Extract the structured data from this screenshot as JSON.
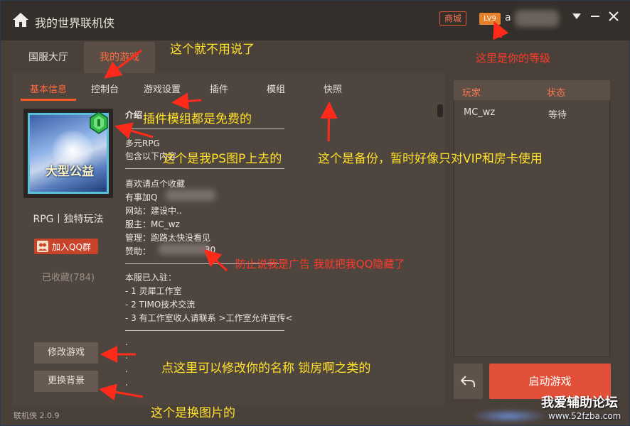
{
  "app": {
    "title": "我的世界联机侠",
    "version": "联机侠 2.0.9"
  },
  "header": {
    "shop": "商城",
    "level": "LV9",
    "username_visible": "a"
  },
  "top_tabs": [
    {
      "label": "国服大厅",
      "active": false
    },
    {
      "label": "我的游戏",
      "active": true
    }
  ],
  "sub_tabs": [
    {
      "label": "基本信息",
      "active": true
    },
    {
      "label": "控制台",
      "active": false
    },
    {
      "label": "游戏设置",
      "active": false
    },
    {
      "label": "插件",
      "active": false
    },
    {
      "label": "模组",
      "active": false
    },
    {
      "label": "快照",
      "active": false
    }
  ],
  "left": {
    "avatar_text": "大型公益",
    "server_tag": "RPG丨独特玩法",
    "qq_button": "加入QQ群",
    "favorites": "已收藏(784)",
    "edit_button": "修改游戏",
    "bg_button": "更换背景"
  },
  "description": {
    "title": "介绍",
    "lines": [
      "多元RPG",
      "包含以下内容",
      "喜欢请点个收藏",
      "有事加Q",
      "网站：建设中..",
      "服主：MC_wz",
      "管理：跑路太快没看见",
      "赞助：",
      "本服已入驻：",
      "- 1 灵犀工作室",
      "- 2 TIMO技术交流",
      "- 3 有工作室收人请联系 >工作室允许宣传<",
      ".",
      ".",
      ".",
      "."
    ],
    "sponsor_tail": "30"
  },
  "players": {
    "header_player": "玩家",
    "header_status": "状态",
    "rows": [
      {
        "name": "MC_wz",
        "status": "等待"
      }
    ]
  },
  "actions": {
    "start": "启动游戏"
  },
  "annotations": {
    "no_need": "这个就不用说了",
    "level": "这里是你的等级",
    "free": "插件模组都是免费的",
    "ps": "这个是我PS图P上去的",
    "backup": "这个是备份，暂时好像只对VIP和房卡使用",
    "hidden_qq": "防止说我是广告 我就把我QQ隐藏了",
    "rename": "点这里可以修改你的名称 锁房啊之类的",
    "bg": "这个是换图片的"
  },
  "watermark": {
    "name": "我爱辅助论坛",
    "url": "www.52fzba.com"
  },
  "colors": {
    "accent": "#ff5a2a",
    "start_button": "#e3503a",
    "annotation_yellow": "#ffe12a",
    "annotation_red": "#ff3a2a"
  }
}
